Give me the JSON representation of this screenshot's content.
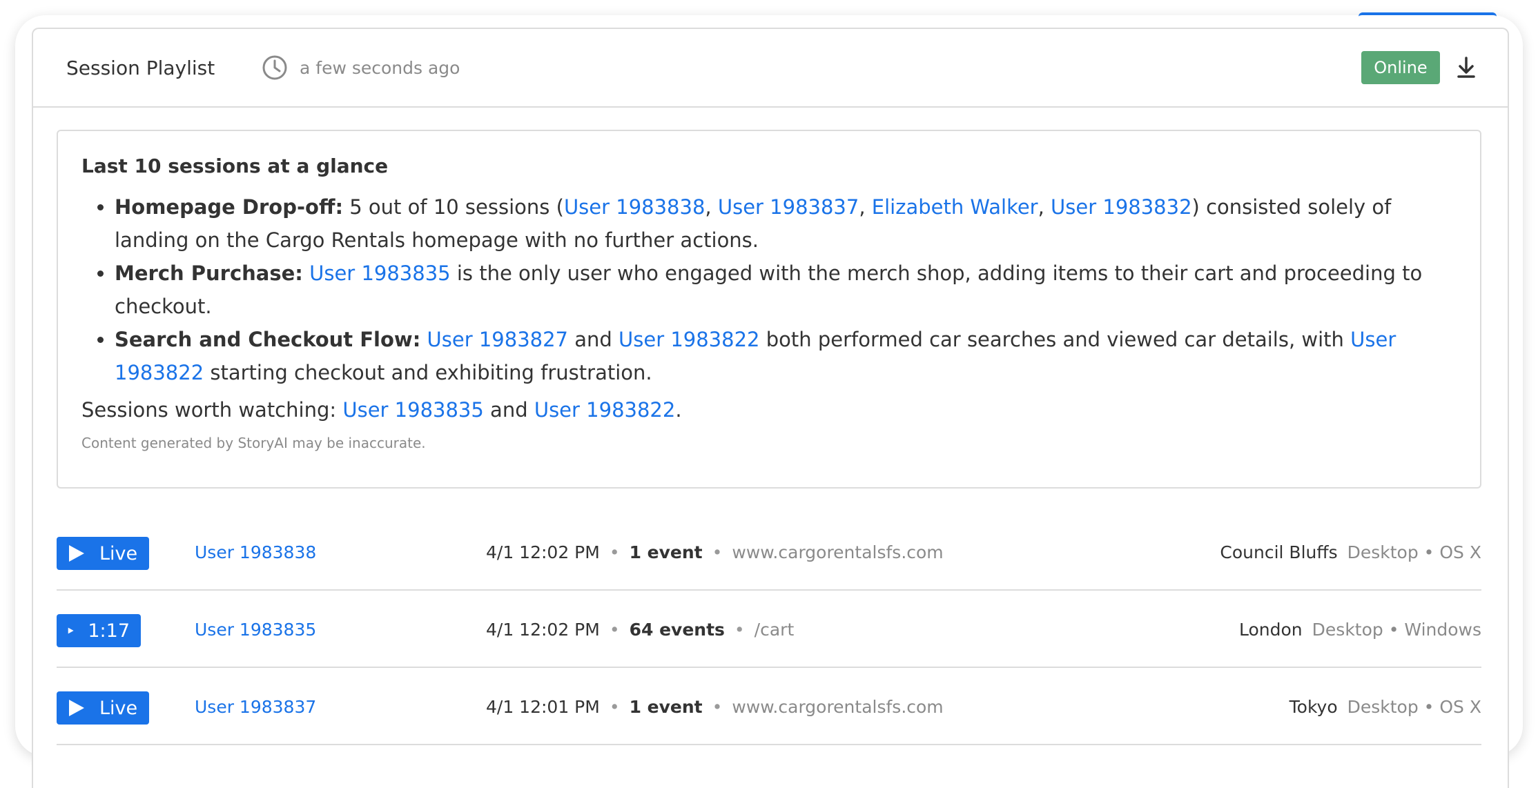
{
  "header": {
    "title": "Session Playlist",
    "time": "a few seconds ago",
    "status": "Online"
  },
  "summary": {
    "heading": "Last 10 sessions at a glance",
    "bullets": [
      {
        "label": "Homepage Drop-off:",
        "t1": " 5 out of 10 sessions (",
        "u1": "User 1983838",
        "s1": ", ",
        "u2": "User 1983837",
        "s2": ", ",
        "u3": "Elizabeth Walker",
        "s3": ", ",
        "u4": "User 1983832",
        "t2": ") consisted solely of landing on the Cargo Rentals homepage with no further actions."
      },
      {
        "label": "Merch Purchase:",
        "u1": "User 1983835",
        "t1": " is the only user who engaged with the merch shop, adding items to their cart and proceeding to checkout."
      },
      {
        "label": "Search and Checkout Flow:",
        "u1": "User 1983827",
        "t1": " and ",
        "u2": "User 1983822",
        "t2": " both performed car searches and viewed car details, with ",
        "u3": "User 1983822",
        "t3": " starting checkout and exhibiting frustration."
      }
    ],
    "worth": {
      "prefix": "Sessions worth watching: ",
      "u1": "User 1983835",
      "mid": " and ",
      "u2": "User 1983822",
      "suffix": "."
    },
    "disclaimer": "Content generated by StoryAI may be inaccurate."
  },
  "sessions": [
    {
      "play": "Live",
      "user": "User 1983838",
      "time": "4/1 12:02 PM",
      "events": "1 event",
      "url": "www.cargorentalsfs.com",
      "city": "Council Bluffs",
      "device": "Desktop • OS X"
    },
    {
      "play": "1:17",
      "user": "User 1983835",
      "time": "4/1 12:02 PM",
      "events": "64 events",
      "url": "/cart",
      "city": "London",
      "device": "Desktop • Windows"
    },
    {
      "play": "Live",
      "user": "User 1983837",
      "time": "4/1 12:01 PM",
      "events": "1 event",
      "url": "www.cargorentalsfs.com",
      "city": "Tokyo",
      "device": "Desktop • OS X"
    }
  ],
  "colors": {
    "accent": "#1a73e8",
    "online": "#5aa876",
    "muted": "#8a8a8a",
    "border": "#dcdcdc"
  },
  "icons": {
    "clock": "clock-icon",
    "download": "download-icon",
    "play": "play-icon"
  }
}
